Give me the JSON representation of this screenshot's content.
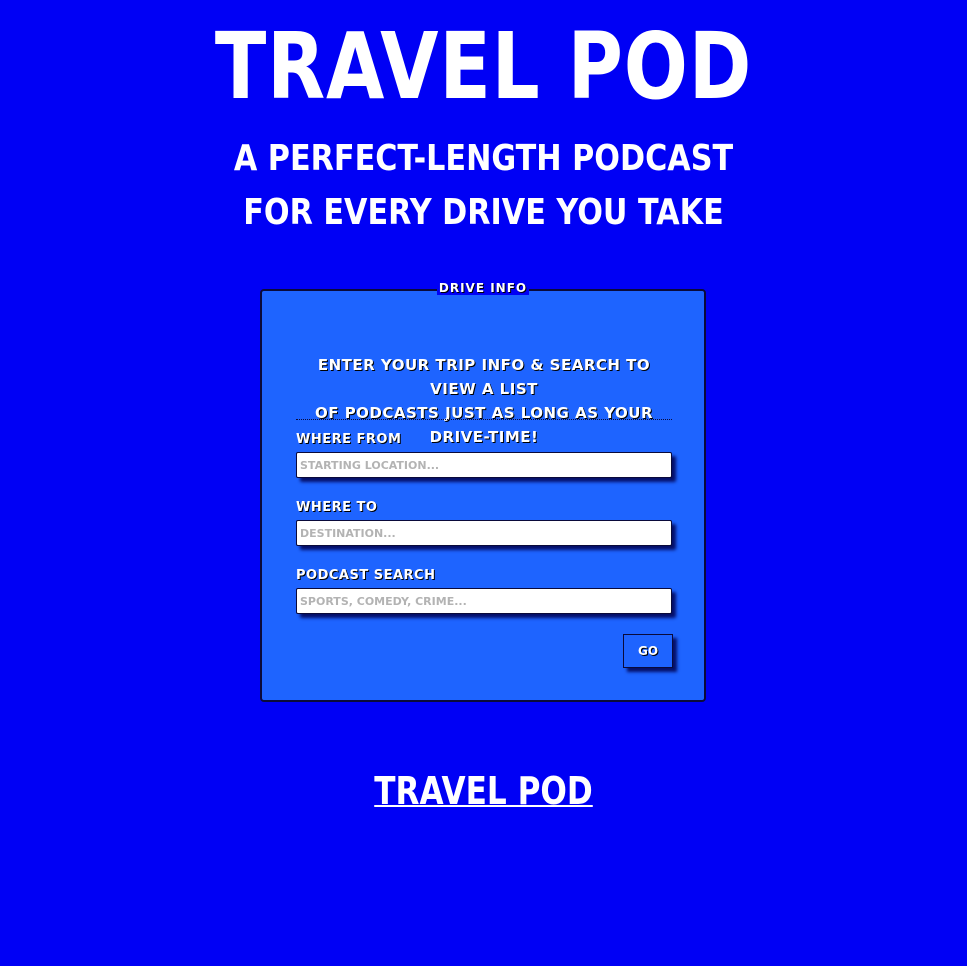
{
  "header": {
    "title": "Travel Pod",
    "tagline_line1": "A perfect-length podcast",
    "tagline_line2": "for every drive you take"
  },
  "form": {
    "legend": "Drive Info",
    "intro_line1": "Enter your trip info & search to view a list",
    "intro_line2": "of podcasts just as long as your drive-time!",
    "from": {
      "label": "Where From",
      "placeholder": "STARTING LOCATION...",
      "value": ""
    },
    "to": {
      "label": "Where To",
      "placeholder": "DESTINATION...",
      "value": ""
    },
    "search": {
      "label": "Podcast Search",
      "placeholder": "SPORTS, COMEDY, CRIME...",
      "value": ""
    },
    "submit_label": "GO"
  },
  "footer": {
    "link_text": "Travel Pod"
  },
  "colors": {
    "background": "#0000f5",
    "panel": "#1e64ff",
    "text": "#ffffff"
  }
}
